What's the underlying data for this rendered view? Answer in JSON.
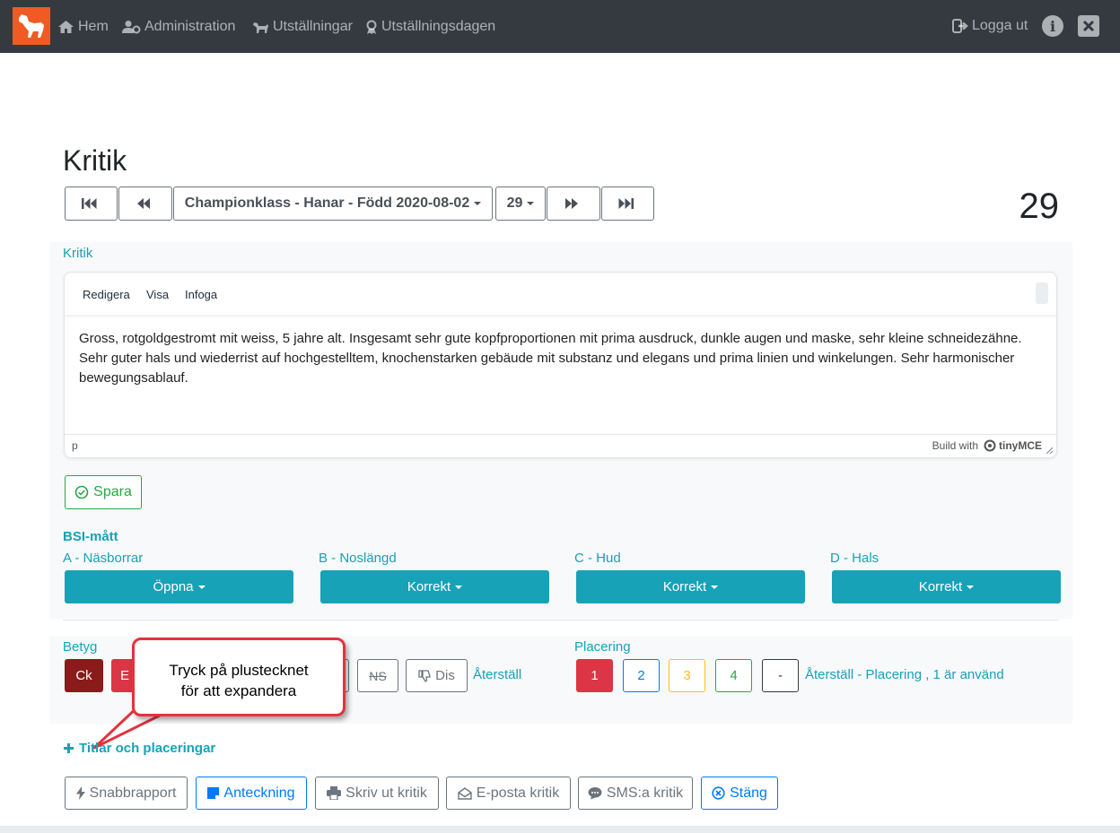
{
  "nav": {
    "home": "Hem",
    "admin": "Administration",
    "shows": "Utställningar",
    "showday": "Utställningsdagen",
    "logout": "Logga ut"
  },
  "page_title": "Kritik",
  "pager": {
    "class_label": "Championklass - Hanar - Född 2020-08-02",
    "number": "29",
    "big_number": "29"
  },
  "critique": {
    "label": "Kritik",
    "menu": [
      "Redigera",
      "Visa",
      "Infoga"
    ],
    "text": "Gross, rotgoldgestromt mit weiss, 5 jahre alt. Insgesamt sehr gute kopfproportionen mit prima ausdruck, dunkle augen und maske, sehr kleine schneidezähne. Sehr guter hals und wiederrist auf hochgestelltem, knochenstarken gebäude mit substanz und elegans und prima linien und winkelungen. Sehr harmonischer bewegungsablauf.",
    "status_path": "p",
    "branding": "Build with",
    "brand_name": "tinyMCE",
    "save": "Spara"
  },
  "bsi": {
    "title": "BSI-mått",
    "fields": [
      {
        "label": "A - Näsborrar",
        "value": "Öppna"
      },
      {
        "label": "B - Noslängd",
        "value": "Korrekt"
      },
      {
        "label": "C - Hud",
        "value": "Korrekt"
      },
      {
        "label": "D - Hals",
        "value": "Korrekt"
      }
    ]
  },
  "grade": {
    "label": "Betyg",
    "ck": "Ck",
    "e": "E",
    "ns": "NS",
    "dis": "Dis",
    "reset": "Återställ"
  },
  "placement": {
    "label": "Placering",
    "options": [
      "1",
      "2",
      "3",
      "4",
      "-"
    ],
    "reset": "Återställ - Placering , 1 är använd"
  },
  "callout": {
    "line1": "Tryck på plustecknet",
    "line2": "för att expandera"
  },
  "titles_link": "Titlar och placeringar",
  "actions": {
    "quick": "Snabbrapport",
    "note": "Anteckning",
    "print": "Skriv ut kritik",
    "email": "E-posta kritik",
    "sms": "SMS:a kritik",
    "close": "Stäng"
  },
  "colors": {
    "navbar": "#343a40",
    "teal": "#17a2b8",
    "green": "#28a745",
    "blue": "#007bff",
    "red": "#dc3545",
    "dark_red": "#8b1a1a",
    "yellow": "#ffc107",
    "logo": "#f05a23"
  }
}
